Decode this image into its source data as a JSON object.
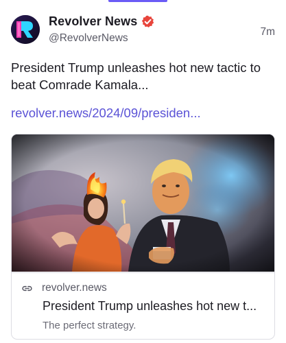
{
  "post": {
    "author": {
      "display_name": "Revolver News",
      "handle": "@RevolverNews",
      "avatar_icon": "revolver-logo-icon",
      "verified_icon": "verified-badge-icon",
      "verified_color": "#e8453c"
    },
    "timestamp": "7m",
    "text": "President Trump unleashes hot new tactic to beat Comrade Kamala...",
    "link_text": "revolver.news/2024/09/presiden..."
  },
  "link_card": {
    "image_alt": "Illustration of Donald Trump holding a lit match beside a woman whose hair is on fire",
    "domain": "revolver.news",
    "domain_icon": "link-icon",
    "title": "President Trump unleashes hot new t...",
    "description": "The perfect strategy."
  },
  "colors": {
    "accent": "#6a5cf6",
    "link": "#5b53d6",
    "text": "#1c1b22",
    "muted": "#5a5a66",
    "border": "#dcdce3"
  }
}
